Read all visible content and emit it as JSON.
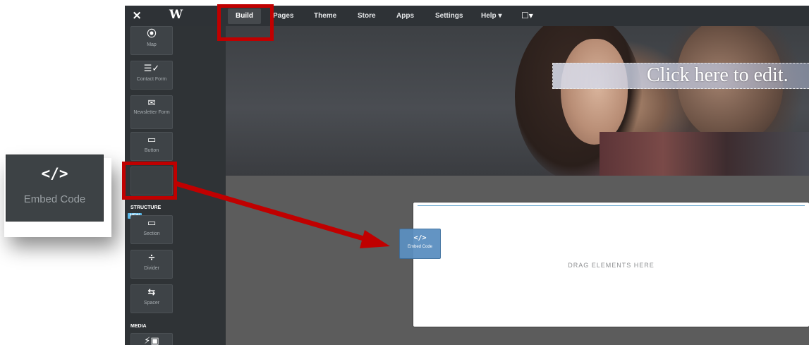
{
  "callout": {
    "icon": "</>",
    "icon_name": "code-icon",
    "label": "Embed Code"
  },
  "topbar": {
    "close": "×",
    "logo": "W",
    "nav": [
      "Build",
      "Pages",
      "Theme",
      "Store",
      "Apps",
      "Settings",
      "Help ▾"
    ],
    "device_icon": "☐▾"
  },
  "sidebar": {
    "items": [
      {
        "icon": "⦿",
        "icon_name": "map-pin-icon",
        "label": "Map"
      },
      {
        "icon": "☰✓",
        "icon_name": "contact-form-icon",
        "label": "Contact Form"
      },
      {
        "icon": "✉",
        "icon_name": "envelope-icon",
        "label": "Newsletter Form"
      },
      {
        "icon": "▭",
        "icon_name": "button-icon",
        "label": "Button"
      }
    ],
    "structure_heading": "STRUCTURE",
    "new_badge": "NEW",
    "structure_items": [
      {
        "icon": "▭",
        "icon_name": "section-icon",
        "label": "Section"
      },
      {
        "icon": "÷",
        "icon_name": "divider-icon",
        "label": "Divider"
      },
      {
        "icon": "⇆",
        "icon_name": "spacer-icon",
        "label": "Spacer"
      }
    ],
    "media_heading": "MEDIA",
    "media_item_icon": "⚡▣"
  },
  "hero": {
    "edit_text": "Click here to edit."
  },
  "dropzone": {
    "text": "DRAG ELEMENTS HERE"
  },
  "drag_tile": {
    "icon": "</>",
    "label": "Embed Code"
  },
  "colors": {
    "annotation_red": "#c00000",
    "drag_blue": "#5b8fc0",
    "sidebar": "#2f3336"
  }
}
